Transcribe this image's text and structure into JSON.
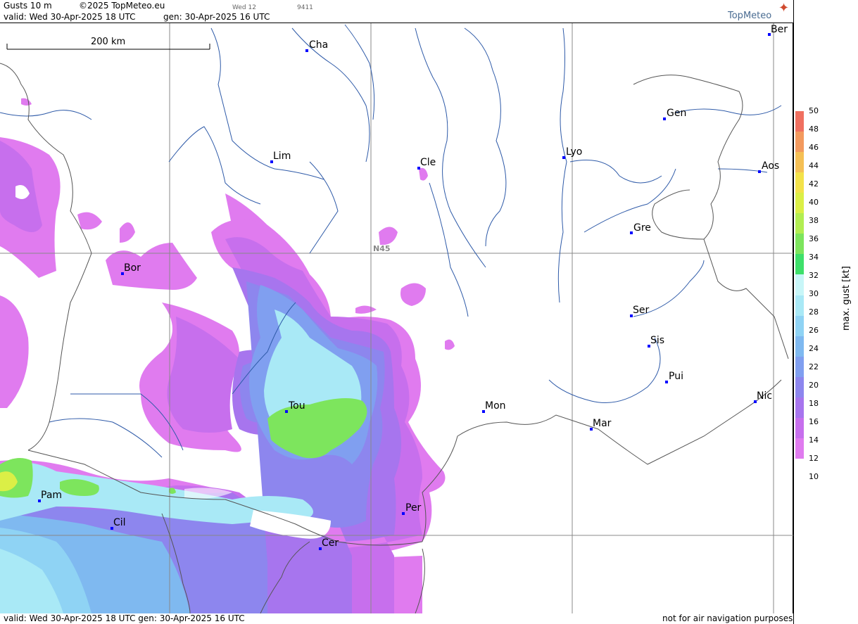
{
  "header": {
    "product": "Gusts 10 m",
    "copyright": "©2025 TopMeteo.eu",
    "day": "Wed 12",
    "code": "9411",
    "valid": "valid:  Wed  30-Apr-2025  18 UTC",
    "gen": "gen:  30-Apr-2025 16 UTC",
    "logo": "TopMeteo"
  },
  "map": {
    "scale_label": "200 km",
    "grid_label": "N45",
    "cities": [
      {
        "name": "Cha"
      },
      {
        "name": "Ber"
      },
      {
        "name": "Gen"
      },
      {
        "name": "Lim"
      },
      {
        "name": "Cle"
      },
      {
        "name": "Lyo"
      },
      {
        "name": "Aos"
      },
      {
        "name": "Gre"
      },
      {
        "name": "Bor"
      },
      {
        "name": "Ser"
      },
      {
        "name": "Sis"
      },
      {
        "name": "Pui"
      },
      {
        "name": "Tou"
      },
      {
        "name": "Mon"
      },
      {
        "name": "Nic"
      },
      {
        "name": "Mar"
      },
      {
        "name": "Pam"
      },
      {
        "name": "Per"
      },
      {
        "name": "Cil"
      },
      {
        "name": "Cer"
      }
    ]
  },
  "legend": {
    "title": "max. gust  [kt]",
    "ticks": [
      "50",
      "48",
      "46",
      "44",
      "42",
      "40",
      "38",
      "36",
      "34",
      "32",
      "30",
      "28",
      "26",
      "24",
      "22",
      "20",
      "18",
      "16",
      "14",
      "12",
      "10"
    ],
    "colors": [
      "#f07060",
      "#f39a5e",
      "#f5c055",
      "#f3e24a",
      "#dbef46",
      "#b2ee52",
      "#7de55d",
      "#3ee06a",
      "#c8f6f8",
      "#a9e9f6",
      "#8fd3f4",
      "#7fb9f0",
      "#809ff0",
      "#8d86ee",
      "#a775ee",
      "#c76fed",
      "#e07bef"
    ]
  },
  "footer": {
    "left": "valid:  Wed  30-Apr-2025  18 UTC      gen:  30-Apr-2025 16 UTC",
    "right": "not for air navigation purposes"
  }
}
